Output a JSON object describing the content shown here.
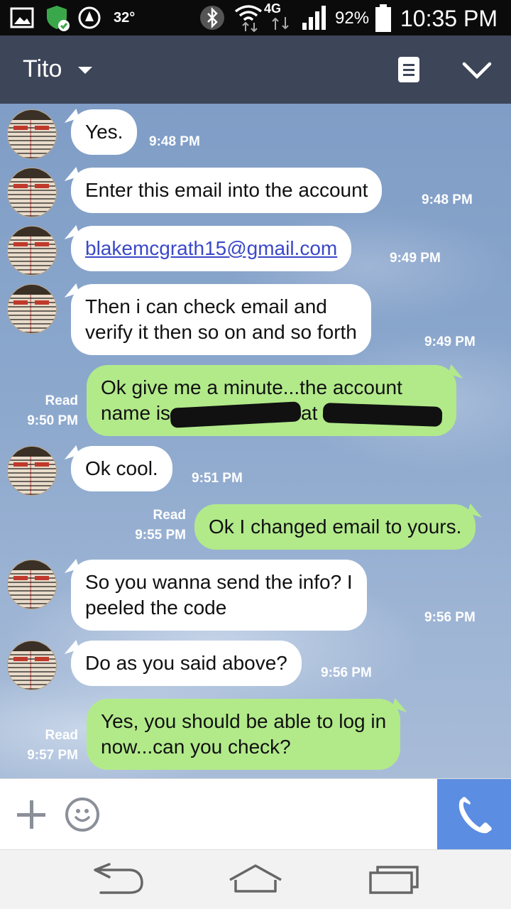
{
  "status_bar": {
    "temperature": "32°",
    "network": "4G",
    "battery": "92%",
    "time": "10:35 PM"
  },
  "header": {
    "contact_name": "Tito",
    "icons": [
      "dropdown-caret-icon",
      "memo-icon",
      "chevron-down-icon"
    ]
  },
  "messages": [
    {
      "side": "in",
      "text": "Yes.",
      "time": "9:48 PM"
    },
    {
      "side": "in",
      "text": "Enter this email into the account",
      "time": "9:48 PM"
    },
    {
      "side": "in",
      "text": "blakemcgrath15@gmail.com",
      "time": "9:49 PM",
      "is_link": true
    },
    {
      "side": "in",
      "line1": "Then i can check email and",
      "line2": "verify it then so on and so forth",
      "time": "9:49 PM"
    },
    {
      "side": "out",
      "line1": "Ok give me a minute...the account",
      "line2_prefix": "name is",
      "line2_mid": "at",
      "read": "Read",
      "time": "9:50 PM"
    },
    {
      "side": "in",
      "text": "Ok cool.",
      "time": "9:51 PM"
    },
    {
      "side": "out",
      "text": "Ok I changed email to yours.",
      "read": "Read",
      "time": "9:55 PM"
    },
    {
      "side": "in",
      "line1": "So you wanna send the info? I",
      "line2": "peeled the code",
      "time": "9:56 PM"
    },
    {
      "side": "in",
      "text": "Do as you said above?",
      "time": "9:56 PM"
    },
    {
      "side": "out",
      "line1": "Yes, you should be able to log in",
      "line2": "now...can you check?",
      "read": "Read",
      "time": "9:57 PM"
    }
  ],
  "colors": {
    "header_bg": "#3d4558",
    "outgoing_bubble": "#b2ea8a",
    "incoming_bubble": "#ffffff",
    "call_button": "#5b8de2",
    "link": "#3b48c8"
  }
}
